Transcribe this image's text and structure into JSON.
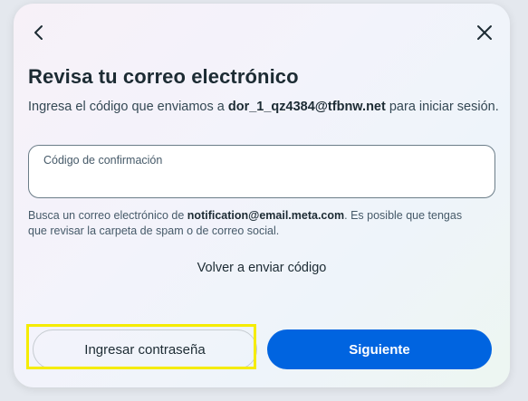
{
  "dialog": {
    "title": "Revisa tu correo electrónico",
    "subtitle_prefix": "Ingresa el código que enviamos a ",
    "email": "dor_1_qz4384@tfbnw.net",
    "subtitle_suffix": " para iniciar sesión.",
    "code_field": {
      "label": "Código de confirmación",
      "value": ""
    },
    "help_prefix": "Busca un correo electrónico de ",
    "help_sender": "notification@email.meta.com",
    "help_suffix": ". Es posible que tengas que revisar la carpeta de spam o de correo social.",
    "resend_label": "Volver a enviar código",
    "password_button_label": "Ingresar contraseña",
    "next_button_label": "Siguiente"
  },
  "icons": {
    "back": "chevron-left-icon",
    "close": "close-icon"
  },
  "colors": {
    "primary": "#0064e0",
    "highlight": "#f5ec00",
    "text": "#1c2b33"
  }
}
